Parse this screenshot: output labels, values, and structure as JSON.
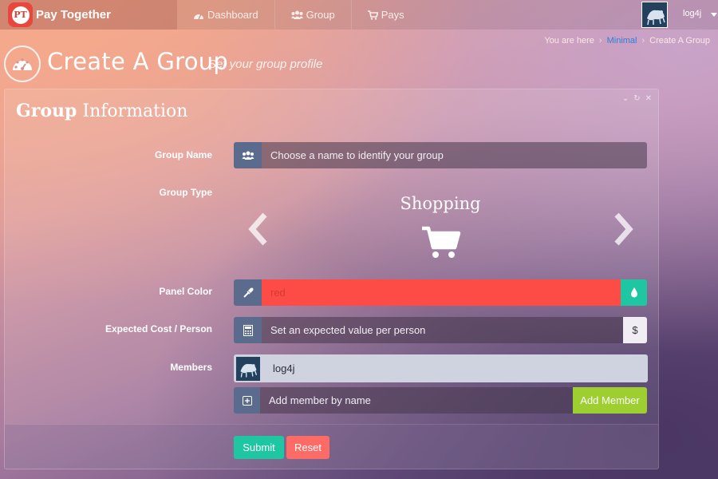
{
  "brand": {
    "logo_text": "PT",
    "name": "Pay Together"
  },
  "nav": [
    {
      "label": "Dashboard",
      "icon": "dashboard-icon"
    },
    {
      "label": "Group",
      "icon": "users-icon"
    },
    {
      "label": "Pays",
      "icon": "cart-icon"
    }
  ],
  "user": {
    "name": "log4j"
  },
  "breadcrumb": {
    "prefix": "You are here",
    "link": "Minimal",
    "current": "Create A Group"
  },
  "page": {
    "title": "Create A Group",
    "subtitle": "Set your group profile"
  },
  "panel": {
    "title_bold": "Group",
    "title_rest": " Information"
  },
  "form": {
    "group_name": {
      "label": "Group Name",
      "placeholder": "Choose a name to identify your group"
    },
    "group_type": {
      "label": "Group Type",
      "value": "Shopping",
      "icon": "shopping-cart-icon"
    },
    "panel_color": {
      "label": "Panel Color",
      "value": "red",
      "color": "#fc4c45"
    },
    "expected_cost": {
      "label": "Expected Cost / Person",
      "placeholder": "Set an expected value per person",
      "currency": "$"
    },
    "members": {
      "label": "Members",
      "list": [
        {
          "name": "log4j"
        }
      ],
      "add_placeholder": "Add member by name",
      "add_button": "Add Member"
    }
  },
  "actions": {
    "submit": "Submit",
    "reset": "Reset"
  },
  "colors": {
    "accent_teal": "#1ec7a2",
    "accent_green": "#9ccf2f",
    "accent_red": "#fc4c45",
    "reset_red": "#fc6b66",
    "addon_slate": "#5b6b8d"
  }
}
